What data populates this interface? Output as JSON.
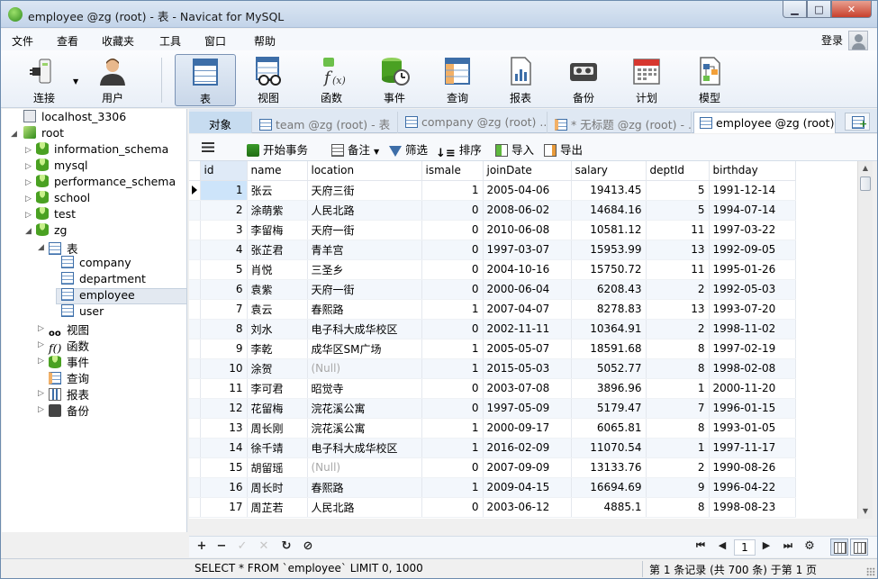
{
  "window": {
    "title": "employee @zg (root) - 表 - Navicat for MySQL"
  },
  "menu": {
    "items": [
      "文件",
      "查看",
      "收藏夹",
      "工具",
      "窗口",
      "帮助"
    ],
    "login": "登录"
  },
  "toolbar": {
    "buttons": [
      {
        "label": "连接",
        "icon": "plug-icon"
      },
      {
        "label": "用户",
        "icon": "user-icon"
      },
      {
        "label": "表",
        "icon": "table-icon"
      },
      {
        "label": "视图",
        "icon": "view-icon"
      },
      {
        "label": "函数",
        "icon": "function-icon"
      },
      {
        "label": "事件",
        "icon": "event-icon"
      },
      {
        "label": "查询",
        "icon": "query-icon"
      },
      {
        "label": "报表",
        "icon": "report-icon"
      },
      {
        "label": "备份",
        "icon": "backup-icon"
      },
      {
        "label": "计划",
        "icon": "calendar-icon"
      },
      {
        "label": "模型",
        "icon": "model-icon"
      }
    ],
    "active": "表"
  },
  "tree": {
    "connection": "localhost_3306",
    "root": "root",
    "databases": [
      "information_schema",
      "mysql",
      "performance_schema",
      "school",
      "test",
      "zg"
    ],
    "tables_folder": "表",
    "tables": [
      "company",
      "department",
      "employee",
      "user"
    ],
    "selected_table": "employee",
    "other_folders": [
      "视图",
      "函数",
      "事件",
      "查询",
      "报表",
      "备份"
    ]
  },
  "tabs": {
    "objects": "对象",
    "items": [
      {
        "label": "team @zg (root) - 表",
        "active": false
      },
      {
        "label": "company @zg (root) ...",
        "active": false
      },
      {
        "label": "* 无标题 @zg (root) - ...",
        "active": false
      },
      {
        "label": "employee @zg (root)...",
        "active": true
      }
    ]
  },
  "table_toolbar": {
    "begin_transaction": "开始事务",
    "memo": "备注",
    "filter": "筛选",
    "sort": "排序",
    "import": "导入",
    "export": "导出"
  },
  "grid": {
    "columns": [
      "id",
      "name",
      "location",
      "ismale",
      "joinDate",
      "salary",
      "deptId",
      "birthday"
    ],
    "rows": [
      [
        "1",
        "张云",
        "天府三街",
        "1",
        "2005-04-06",
        "19413.45",
        "5",
        "1991-12-14"
      ],
      [
        "2",
        "涂萌紫",
        "人民北路",
        "0",
        "2008-06-02",
        "14684.16",
        "5",
        "1994-07-14"
      ],
      [
        "3",
        "李留梅",
        "天府一街",
        "0",
        "2010-06-08",
        "10581.12",
        "11",
        "1997-03-22"
      ],
      [
        "4",
        "张芷君",
        "青羊宫",
        "0",
        "1997-03-07",
        "15953.99",
        "13",
        "1992-09-05"
      ],
      [
        "5",
        "肖悦",
        "三圣乡",
        "0",
        "2004-10-16",
        "15750.72",
        "11",
        "1995-01-26"
      ],
      [
        "6",
        "袁紫",
        "天府一街",
        "0",
        "2000-06-04",
        "6208.43",
        "2",
        "1992-05-03"
      ],
      [
        "7",
        "袁云",
        "春熙路",
        "1",
        "2007-04-07",
        "8278.83",
        "13",
        "1993-07-20"
      ],
      [
        "8",
        "刘水",
        "电子科大成华校区",
        "0",
        "2002-11-11",
        "10364.91",
        "2",
        "1998-11-02"
      ],
      [
        "9",
        "李乾",
        "成华区SM广场",
        "1",
        "2005-05-07",
        "18591.68",
        "8",
        "1997-02-19"
      ],
      [
        "10",
        "涂贺",
        "(Null)",
        "1",
        "2015-05-03",
        "5052.77",
        "8",
        "1998-02-08"
      ],
      [
        "11",
        "李可君",
        "昭觉寺",
        "0",
        "2003-07-08",
        "3896.96",
        "1",
        "2000-11-20"
      ],
      [
        "12",
        "花留梅",
        "浣花溪公寓",
        "0",
        "1997-05-09",
        "5179.47",
        "7",
        "1996-01-15"
      ],
      [
        "13",
        "周长刚",
        "浣花溪公寓",
        "1",
        "2000-09-17",
        "6065.81",
        "8",
        "1993-01-05"
      ],
      [
        "14",
        "徐千靖",
        "电子科大成华校区",
        "1",
        "2016-02-09",
        "11070.54",
        "1",
        "1997-11-17"
      ],
      [
        "15",
        "胡留瑶",
        "(Null)",
        "0",
        "2007-09-09",
        "13133.76",
        "2",
        "1990-08-26"
      ],
      [
        "16",
        "周长时",
        "春熙路",
        "1",
        "2009-04-15",
        "16694.69",
        "9",
        "1996-04-22"
      ],
      [
        "17",
        "周芷若",
        "人民北路",
        "0",
        "2003-06-12",
        "4885.1",
        "8",
        "1998-08-23"
      ]
    ]
  },
  "navbar": {
    "page": "1"
  },
  "status": {
    "sql": "SELECT * FROM `employee` LIMIT 0, 1000",
    "records": "第 1 条记录 (共 700 条) 于第 1 页"
  },
  "colors": {
    "accent": "#3d6ea8",
    "selection": "#cde4fa",
    "alt_row": "#f3f7fc",
    "null_text": "#a8a8a8"
  }
}
